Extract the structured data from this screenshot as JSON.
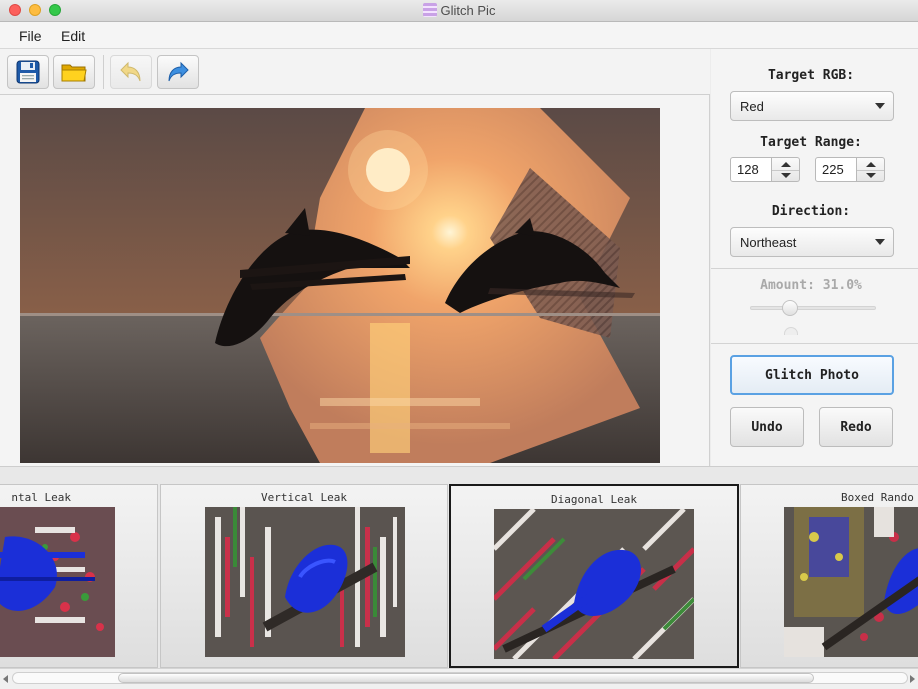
{
  "window": {
    "title": "Glitch Pic"
  },
  "menu": {
    "file": "File",
    "edit": "Edit"
  },
  "toolbar": {
    "save": "save-icon",
    "open": "folder-icon",
    "undo": "undo-icon",
    "redo": "redo-icon"
  },
  "panel": {
    "target_rgb_label": "Target RGB:",
    "target_rgb_value": "Red",
    "target_range_label": "Target Range:",
    "range_min": "128",
    "range_max": "225",
    "direction_label": "Direction:",
    "direction_value": "Northeast",
    "amount_label": "Amount: 31.0%",
    "amount_value": 0.31,
    "glitch_button": "Glitch Photo",
    "undo_button": "Undo",
    "redo_button": "Redo"
  },
  "filters": [
    {
      "label": "ntal Leak"
    },
    {
      "label": "Vertical Leak"
    },
    {
      "label": "Diagonal Leak"
    },
    {
      "label": "Boxed Rando"
    }
  ],
  "colors": {
    "accent": "#5aa1e3",
    "selected_border": "#1a1a1a"
  }
}
